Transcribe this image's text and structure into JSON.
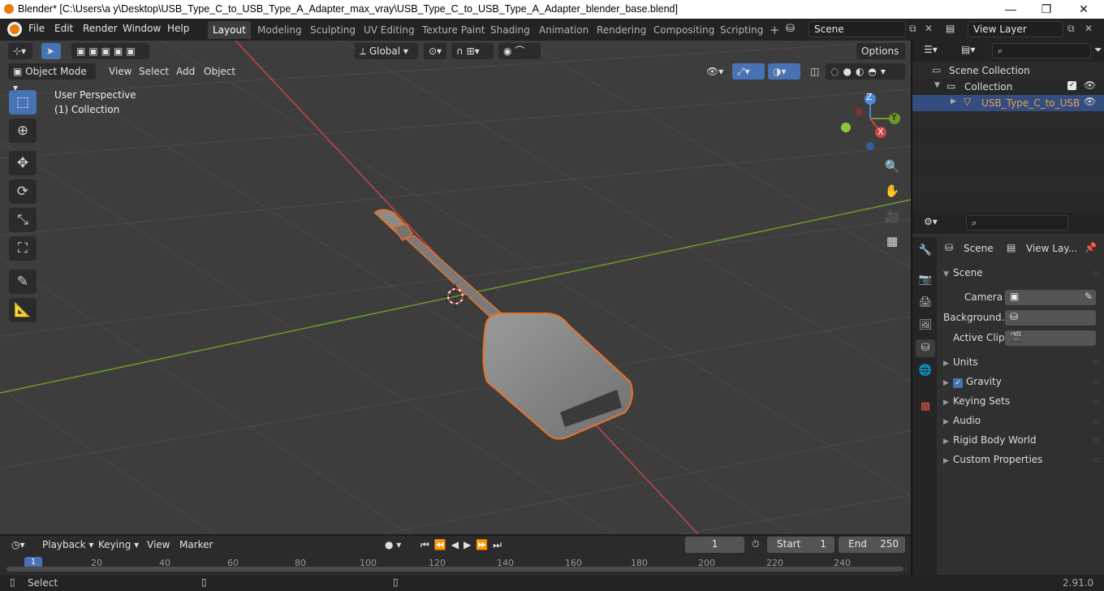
{
  "window": {
    "title": "Blender* [C:\\Users\\a y\\Desktop\\USB_Type_C_to_USB_Type_A_Adapter_max_vray\\USB_Type_C_to_USB_Type_A_Adapter_blender_base.blend]",
    "controls": {
      "minimize": "—",
      "maximize": "❐",
      "close": "✕"
    }
  },
  "topbar": {
    "menus": [
      "File",
      "Edit",
      "Render",
      "Window",
      "Help"
    ],
    "workspaces": [
      "Layout",
      "Modeling",
      "Sculpting",
      "UV Editing",
      "Texture Paint",
      "Shading",
      "Animation",
      "Rendering",
      "Compositing",
      "Scripting"
    ],
    "active_workspace": "Layout",
    "add_tab": "+",
    "scene": "Scene",
    "view_layer": "View Layer"
  },
  "viewport_header": {
    "transform_orientation": "Global",
    "options": "Options",
    "mode": "Object Mode",
    "menus": [
      "View",
      "Select",
      "Add",
      "Object"
    ]
  },
  "viewport": {
    "perspective": "User Perspective",
    "collection": "(1) Collection",
    "gizmo": {
      "z": "Z",
      "y": "Y",
      "x": "X"
    }
  },
  "outliner": {
    "root": "Scene Collection",
    "collection": "Collection",
    "object": "USB_Type_C_to_USB"
  },
  "properties": {
    "breadcrumb": {
      "scene": "Scene",
      "view_layer": "View Lay..."
    },
    "panel_title": "Scene",
    "fields": {
      "camera_label": "Camera",
      "background_label": "Background...",
      "active_clip_label": "Active Clip"
    },
    "sections": [
      "Units",
      "Gravity",
      "Keying Sets",
      "Audio",
      "Rigid Body World",
      "Custom Properties"
    ],
    "gravity_enabled": true
  },
  "timeline": {
    "menus": [
      "Playback",
      "Keying",
      "View",
      "Marker"
    ],
    "current_frame": "1",
    "start_label": "Start",
    "start_value": "1",
    "end_label": "End",
    "end_value": "250",
    "ruler": [
      "1",
      "20",
      "40",
      "60",
      "80",
      "100",
      "120",
      "140",
      "160",
      "180",
      "200",
      "220",
      "240"
    ]
  },
  "statusbar": {
    "select": "Select",
    "version": "2.91.0"
  },
  "colors": {
    "accent": "#4772b3",
    "selection_outline": "#e8722a",
    "x_axis": "#c94545",
    "y_axis": "#6d9a2b",
    "object": "#8b8b8b"
  }
}
